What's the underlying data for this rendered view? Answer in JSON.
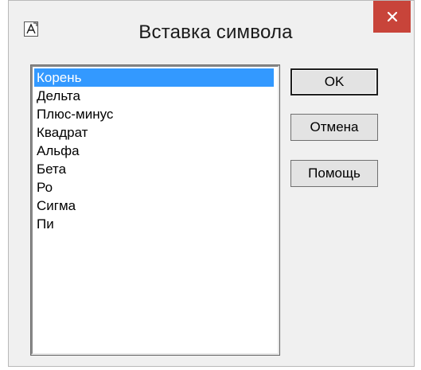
{
  "dialog": {
    "title": "Вставка символа",
    "app_icon": "font-A-icon",
    "close_icon": "close-x-icon",
    "close_color": "#c8443a"
  },
  "list": {
    "items": [
      "Корень",
      "Дельта",
      "Плюс-минус",
      "Квадрат",
      "Альфа",
      "Бета",
      "Ро",
      "Сигма",
      "Пи"
    ],
    "selected_index": 0,
    "selection_color": "#3399ff"
  },
  "buttons": {
    "ok_label": "OK",
    "cancel_label": "Отмена",
    "help_label": "Помощь"
  }
}
